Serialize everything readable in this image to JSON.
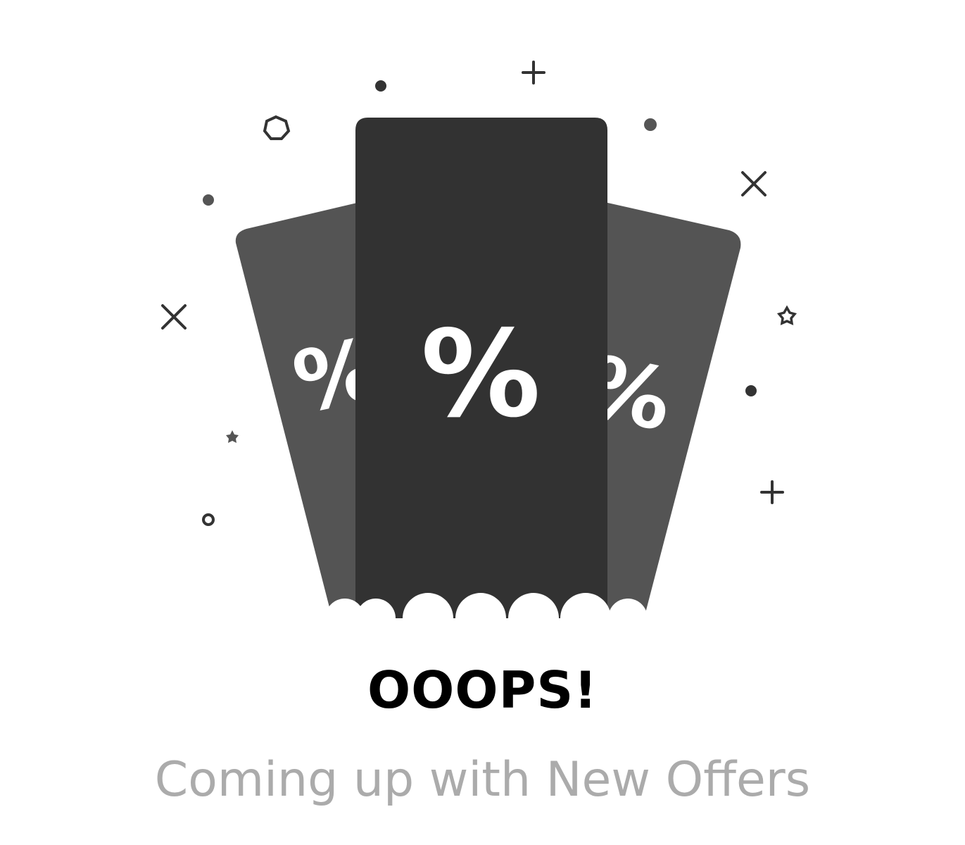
{
  "empty_state": {
    "title": "OOOPS!",
    "message": "Coming up with New Offers",
    "ticket_glyph": "%",
    "colors": {
      "front_ticket": "#323232",
      "back_tickets": "#545454",
      "decor": "#333333",
      "title": "#000000",
      "message": "#ababab"
    },
    "icons": [
      "discount-ticket-icon",
      "sparkle-decorations"
    ]
  }
}
